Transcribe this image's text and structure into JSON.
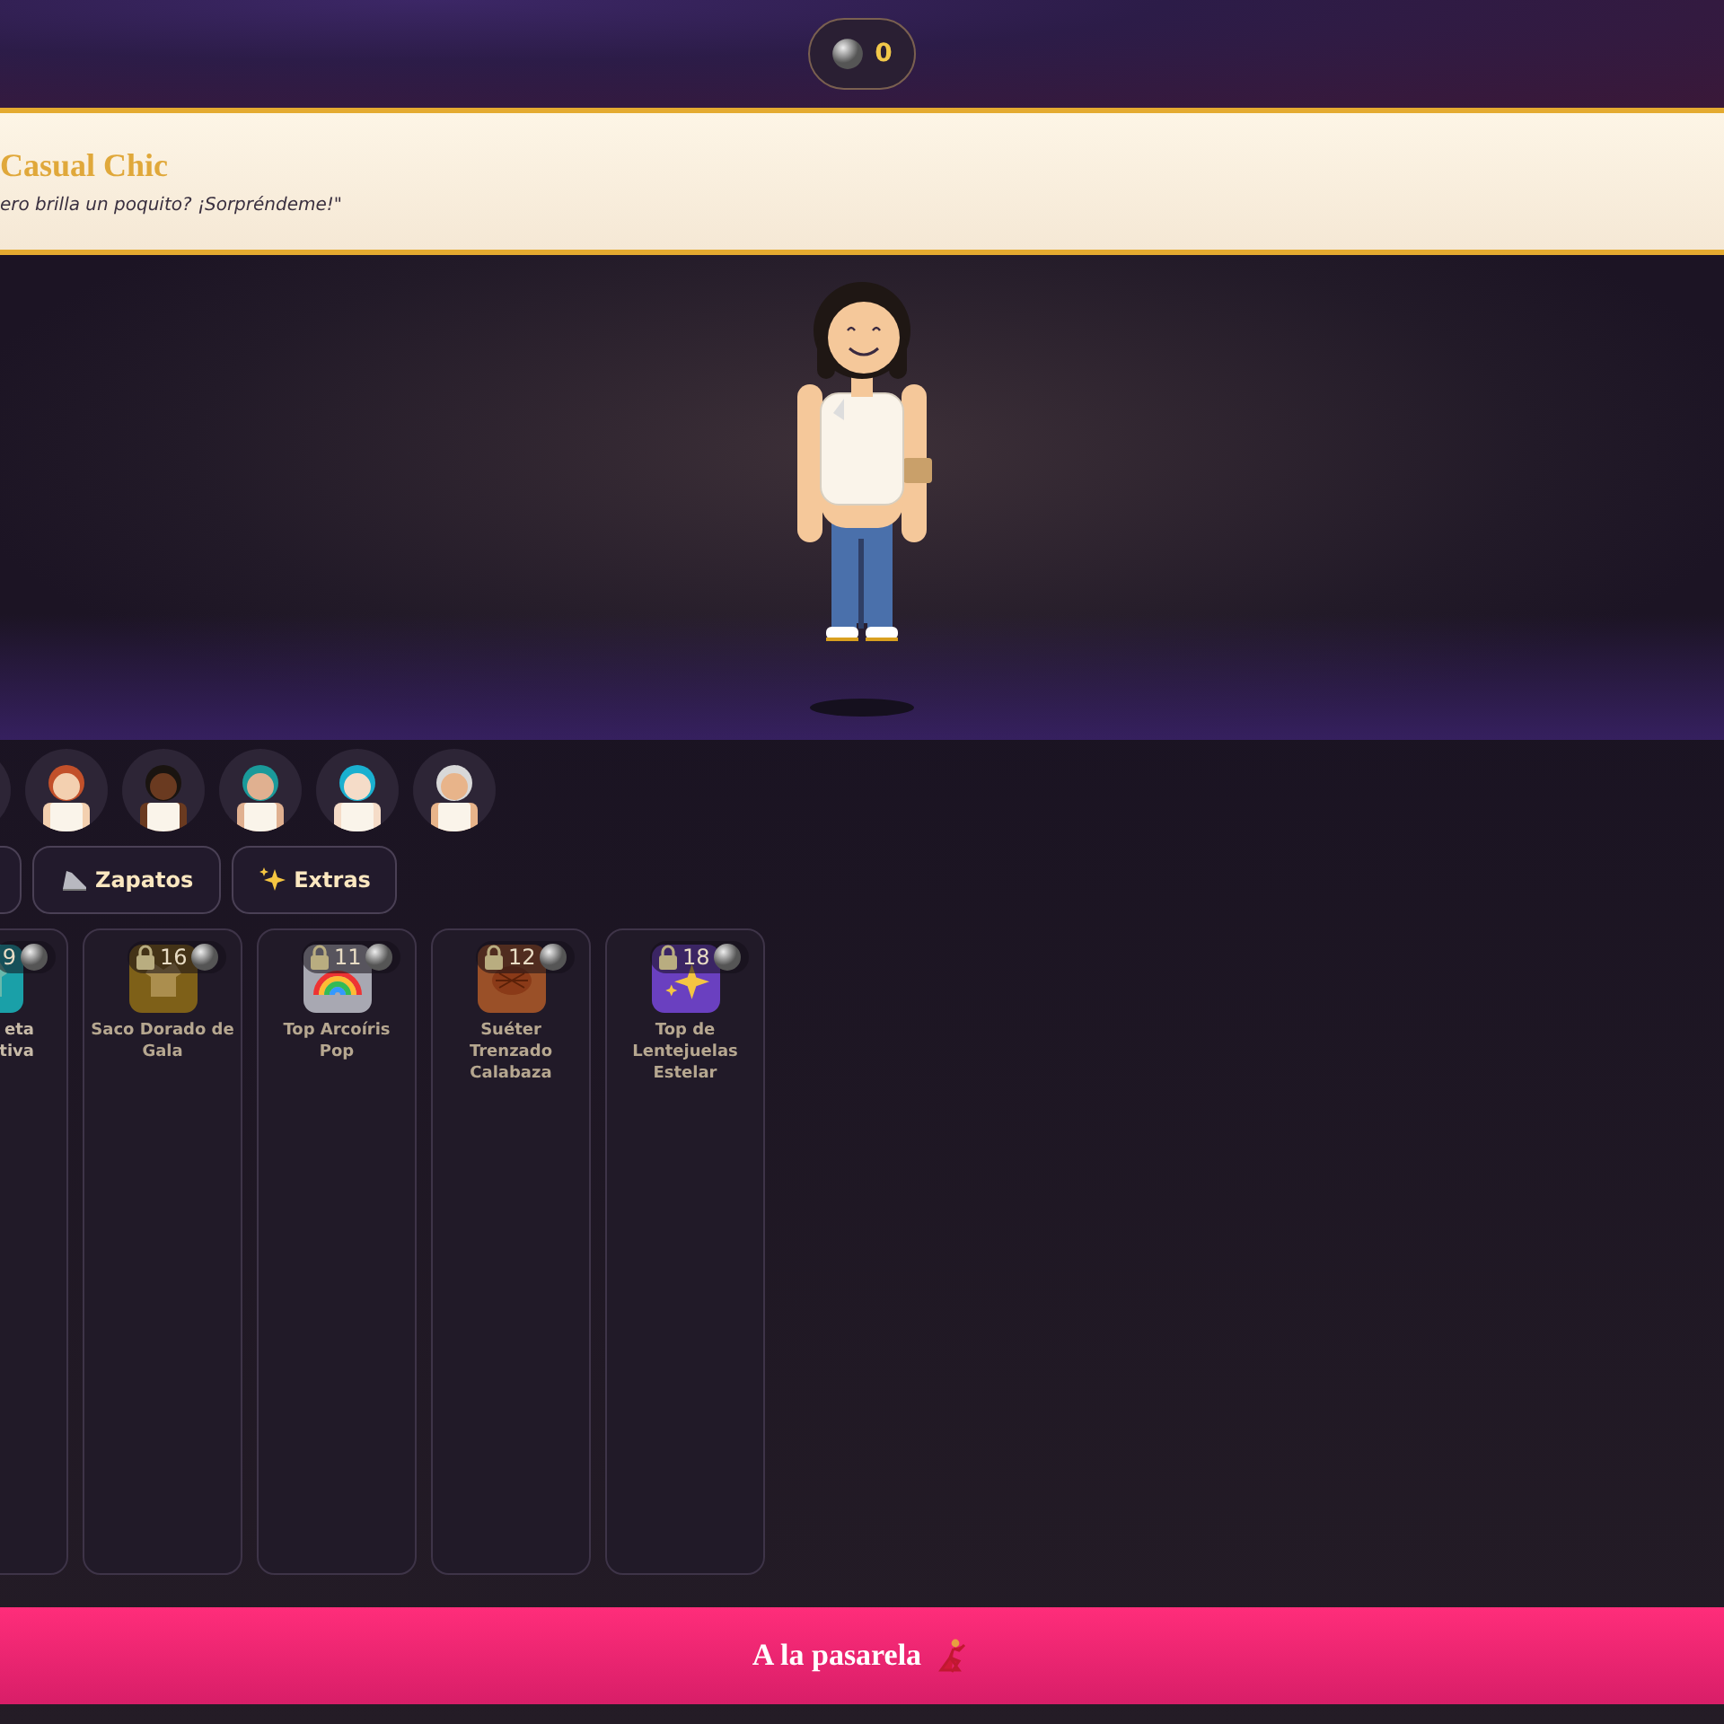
{
  "coins": {
    "count": "0"
  },
  "banner": {
    "title": "Casual Chic",
    "quote": "ero brilla un poquito? ¡Sorpréndeme!\""
  },
  "avatars": [
    {
      "kind": "cut"
    },
    {
      "color": "#c2502a"
    },
    {
      "color": "#1a1410"
    },
    {
      "color": "#1a9a9a"
    },
    {
      "color": "#1ab0d0"
    },
    {
      "color": "#d8d8d8"
    }
  ],
  "categories": [
    {
      "kind": "cut"
    },
    {
      "label": "Zapatos",
      "kind": "shoe"
    },
    {
      "label": "Extras",
      "kind": "sparkles"
    }
  ],
  "items": [
    {
      "name": "eta\ntiva",
      "price": "9",
      "color": "#1aa0a8",
      "kind": "jacket",
      "locked": false,
      "cut_left": true
    },
    {
      "name": "Saco Dorado de Gala",
      "price": "16",
      "color": "#7e6018",
      "kind": "jacket",
      "locked": true,
      "cut_left": false
    },
    {
      "name": "Top Arcoíris Pop",
      "price": "11",
      "color": "#a8a8b2",
      "kind": "rainbow",
      "locked": true,
      "cut_left": false
    },
    {
      "name": "Suéter Trenzado Calabaza",
      "price": "12",
      "color": "#9a5028",
      "kind": "sweater",
      "locked": true,
      "cut_left": false
    },
    {
      "name": "Top de Lentejuelas Estelar",
      "price": "18",
      "color": "#6a40c0",
      "kind": "sparkles",
      "locked": true,
      "cut_left": false
    }
  ],
  "action": {
    "label": "A la pasarela"
  }
}
